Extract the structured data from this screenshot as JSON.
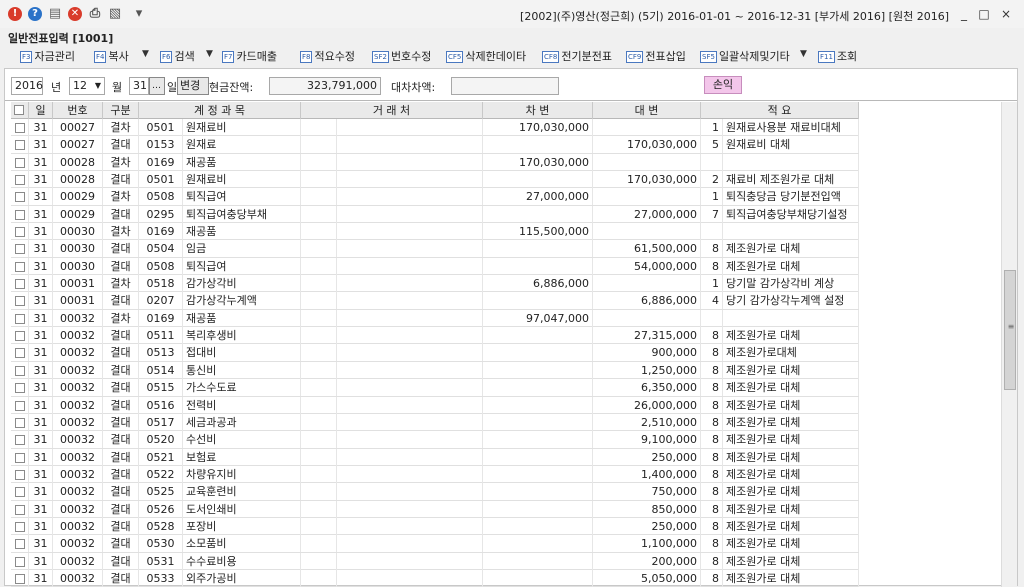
{
  "window": {
    "title": "[2002](주)영산(정근희) (5기) 2016-01-01 ~ 2016-12-31 [부가세 2016] [원천 2016]",
    "minimize": "_",
    "maximize": "□",
    "close": "×"
  },
  "quick_icons": [
    {
      "name": "error-icon",
      "glyph": "!",
      "color": "#d93b2b"
    },
    {
      "name": "help-icon",
      "glyph": "?",
      "color": "#2a72c8"
    },
    {
      "name": "memo-icon",
      "glyph": "▤",
      "color": "#666666"
    },
    {
      "name": "close-circle-icon",
      "glyph": "✕",
      "color": "#d93b2b"
    },
    {
      "name": "print-icon",
      "glyph": "⎙",
      "color": "#555555"
    },
    {
      "name": "search-doc-icon",
      "glyph": "▧",
      "color": "#555555"
    },
    {
      "name": "menu-expand-icon",
      "glyph": "▾",
      "color": "#555555"
    }
  ],
  "screen_title": "일반전표입력 [1001]",
  "toolbar": [
    {
      "key": "F3",
      "label": "자금관리"
    },
    {
      "key": "F4",
      "label": "복사"
    },
    {
      "key": "F6",
      "label": "검색"
    },
    {
      "key": "F7",
      "label": "카드매출"
    },
    {
      "key": "F8",
      "label": "적요수정"
    },
    {
      "key": "SF2",
      "label": "번호수정"
    },
    {
      "key": "CF5",
      "label": "삭제한데이타"
    },
    {
      "key": "CF8",
      "label": "전기분전표"
    },
    {
      "key": "CF9",
      "label": "전표삽입"
    },
    {
      "key": "SF5",
      "label": "일괄삭제및기타"
    },
    {
      "key": "F11",
      "label": "조회"
    }
  ],
  "filter": {
    "year": "2016",
    "year_label": "년",
    "month": "12",
    "month_label": "월",
    "day": "31",
    "day_label": "일",
    "change_button": "변경",
    "cash_label": "현금잔액:",
    "cash_value": "323,791,000",
    "diff_label": "대차차액:",
    "diff_value": "",
    "pl_button": "손익"
  },
  "columns": [
    "일",
    "번호",
    "구분",
    "계 정 과 목",
    "거 래 처",
    "차 변",
    "대 변",
    "적 요"
  ],
  "rows": [
    {
      "day": "31",
      "no": "00027",
      "type": "결차",
      "code": "0501",
      "account": "원재료비",
      "partner": "",
      "debit": "170,030,000",
      "credit": "",
      "mcode": "1",
      "memo": "원재료사용분 재료비대체"
    },
    {
      "day": "31",
      "no": "00027",
      "type": "결대",
      "code": "0153",
      "account": "원재료",
      "partner": "",
      "debit": "",
      "credit": "170,030,000",
      "mcode": "5",
      "memo": "원재료비 대체"
    },
    {
      "day": "31",
      "no": "00028",
      "type": "결차",
      "code": "0169",
      "account": "재공품",
      "partner": "",
      "debit": "170,030,000",
      "credit": "",
      "mcode": "",
      "memo": ""
    },
    {
      "day": "31",
      "no": "00028",
      "type": "결대",
      "code": "0501",
      "account": "원재료비",
      "partner": "",
      "debit": "",
      "credit": "170,030,000",
      "mcode": "2",
      "memo": "재료비 제조원가로 대체"
    },
    {
      "day": "31",
      "no": "00029",
      "type": "결차",
      "code": "0508",
      "account": "퇴직급여",
      "partner": "",
      "debit": "27,000,000",
      "credit": "",
      "mcode": "1",
      "memo": "퇴직충당금 당기분전입액"
    },
    {
      "day": "31",
      "no": "00029",
      "type": "결대",
      "code": "0295",
      "account": "퇴직급여충당부채",
      "partner": "",
      "debit": "",
      "credit": "27,000,000",
      "mcode": "7",
      "memo": "퇴직급여충당부채당기설정"
    },
    {
      "day": "31",
      "no": "00030",
      "type": "결차",
      "code": "0169",
      "account": "재공품",
      "partner": "",
      "debit": "115,500,000",
      "credit": "",
      "mcode": "",
      "memo": ""
    },
    {
      "day": "31",
      "no": "00030",
      "type": "결대",
      "code": "0504",
      "account": "임금",
      "partner": "",
      "debit": "",
      "credit": "61,500,000",
      "mcode": "8",
      "memo": "제조원가로 대체"
    },
    {
      "day": "31",
      "no": "00030",
      "type": "결대",
      "code": "0508",
      "account": "퇴직급여",
      "partner": "",
      "debit": "",
      "credit": "54,000,000",
      "mcode": "8",
      "memo": "제조원가로 대체"
    },
    {
      "day": "31",
      "no": "00031",
      "type": "결차",
      "code": "0518",
      "account": "감가상각비",
      "partner": "",
      "debit": "6,886,000",
      "credit": "",
      "mcode": "1",
      "memo": "당기말 감가상각비 계상"
    },
    {
      "day": "31",
      "no": "00031",
      "type": "결대",
      "code": "0207",
      "account": "감가상각누계액",
      "partner": "",
      "debit": "",
      "credit": "6,886,000",
      "mcode": "4",
      "memo": "당기 감가상각누계액 설정"
    },
    {
      "day": "31",
      "no": "00032",
      "type": "결차",
      "code": "0169",
      "account": "재공품",
      "partner": "",
      "debit": "97,047,000",
      "credit": "",
      "mcode": "",
      "memo": ""
    },
    {
      "day": "31",
      "no": "00032",
      "type": "결대",
      "code": "0511",
      "account": "복리후생비",
      "partner": "",
      "debit": "",
      "credit": "27,315,000",
      "mcode": "8",
      "memo": "제조원가로 대체"
    },
    {
      "day": "31",
      "no": "00032",
      "type": "결대",
      "code": "0513",
      "account": "접대비",
      "partner": "",
      "debit": "",
      "credit": "900,000",
      "mcode": "8",
      "memo": "제조원가로대체"
    },
    {
      "day": "31",
      "no": "00032",
      "type": "결대",
      "code": "0514",
      "account": "통신비",
      "partner": "",
      "debit": "",
      "credit": "1,250,000",
      "mcode": "8",
      "memo": "제조원가로 대체"
    },
    {
      "day": "31",
      "no": "00032",
      "type": "결대",
      "code": "0515",
      "account": "가스수도료",
      "partner": "",
      "debit": "",
      "credit": "6,350,000",
      "mcode": "8",
      "memo": "제조원가로 대체"
    },
    {
      "day": "31",
      "no": "00032",
      "type": "결대",
      "code": "0516",
      "account": "전력비",
      "partner": "",
      "debit": "",
      "credit": "26,000,000",
      "mcode": "8",
      "memo": "제조원가로 대체"
    },
    {
      "day": "31",
      "no": "00032",
      "type": "결대",
      "code": "0517",
      "account": "세금과공과",
      "partner": "",
      "debit": "",
      "credit": "2,510,000",
      "mcode": "8",
      "memo": "제조원가로 대체"
    },
    {
      "day": "31",
      "no": "00032",
      "type": "결대",
      "code": "0520",
      "account": "수선비",
      "partner": "",
      "debit": "",
      "credit": "9,100,000",
      "mcode": "8",
      "memo": "제조원가로 대체"
    },
    {
      "day": "31",
      "no": "00032",
      "type": "결대",
      "code": "0521",
      "account": "보험료",
      "partner": "",
      "debit": "",
      "credit": "250,000",
      "mcode": "8",
      "memo": "제조원가로 대체"
    },
    {
      "day": "31",
      "no": "00032",
      "type": "결대",
      "code": "0522",
      "account": "차량유지비",
      "partner": "",
      "debit": "",
      "credit": "1,400,000",
      "mcode": "8",
      "memo": "제조원가로 대체"
    },
    {
      "day": "31",
      "no": "00032",
      "type": "결대",
      "code": "0525",
      "account": "교육훈련비",
      "partner": "",
      "debit": "",
      "credit": "750,000",
      "mcode": "8",
      "memo": "제조원가로 대체"
    },
    {
      "day": "31",
      "no": "00032",
      "type": "결대",
      "code": "0526",
      "account": "도서인쇄비",
      "partner": "",
      "debit": "",
      "credit": "850,000",
      "mcode": "8",
      "memo": "제조원가로 대체"
    },
    {
      "day": "31",
      "no": "00032",
      "type": "결대",
      "code": "0528",
      "account": "포장비",
      "partner": "",
      "debit": "",
      "credit": "250,000",
      "mcode": "8",
      "memo": "제조원가로 대체"
    },
    {
      "day": "31",
      "no": "00032",
      "type": "결대",
      "code": "0530",
      "account": "소모품비",
      "partner": "",
      "debit": "",
      "credit": "1,100,000",
      "mcode": "8",
      "memo": "제조원가로 대체"
    },
    {
      "day": "31",
      "no": "00032",
      "type": "결대",
      "code": "0531",
      "account": "수수료비용",
      "partner": "",
      "debit": "",
      "credit": "200,000",
      "mcode": "8",
      "memo": "제조원가로 대체"
    },
    {
      "day": "31",
      "no": "00032",
      "type": "결대",
      "code": "0533",
      "account": "외주가공비",
      "partner": "",
      "debit": "",
      "credit": "5,050,000",
      "mcode": "8",
      "memo": "제조원가로 대체"
    }
  ]
}
